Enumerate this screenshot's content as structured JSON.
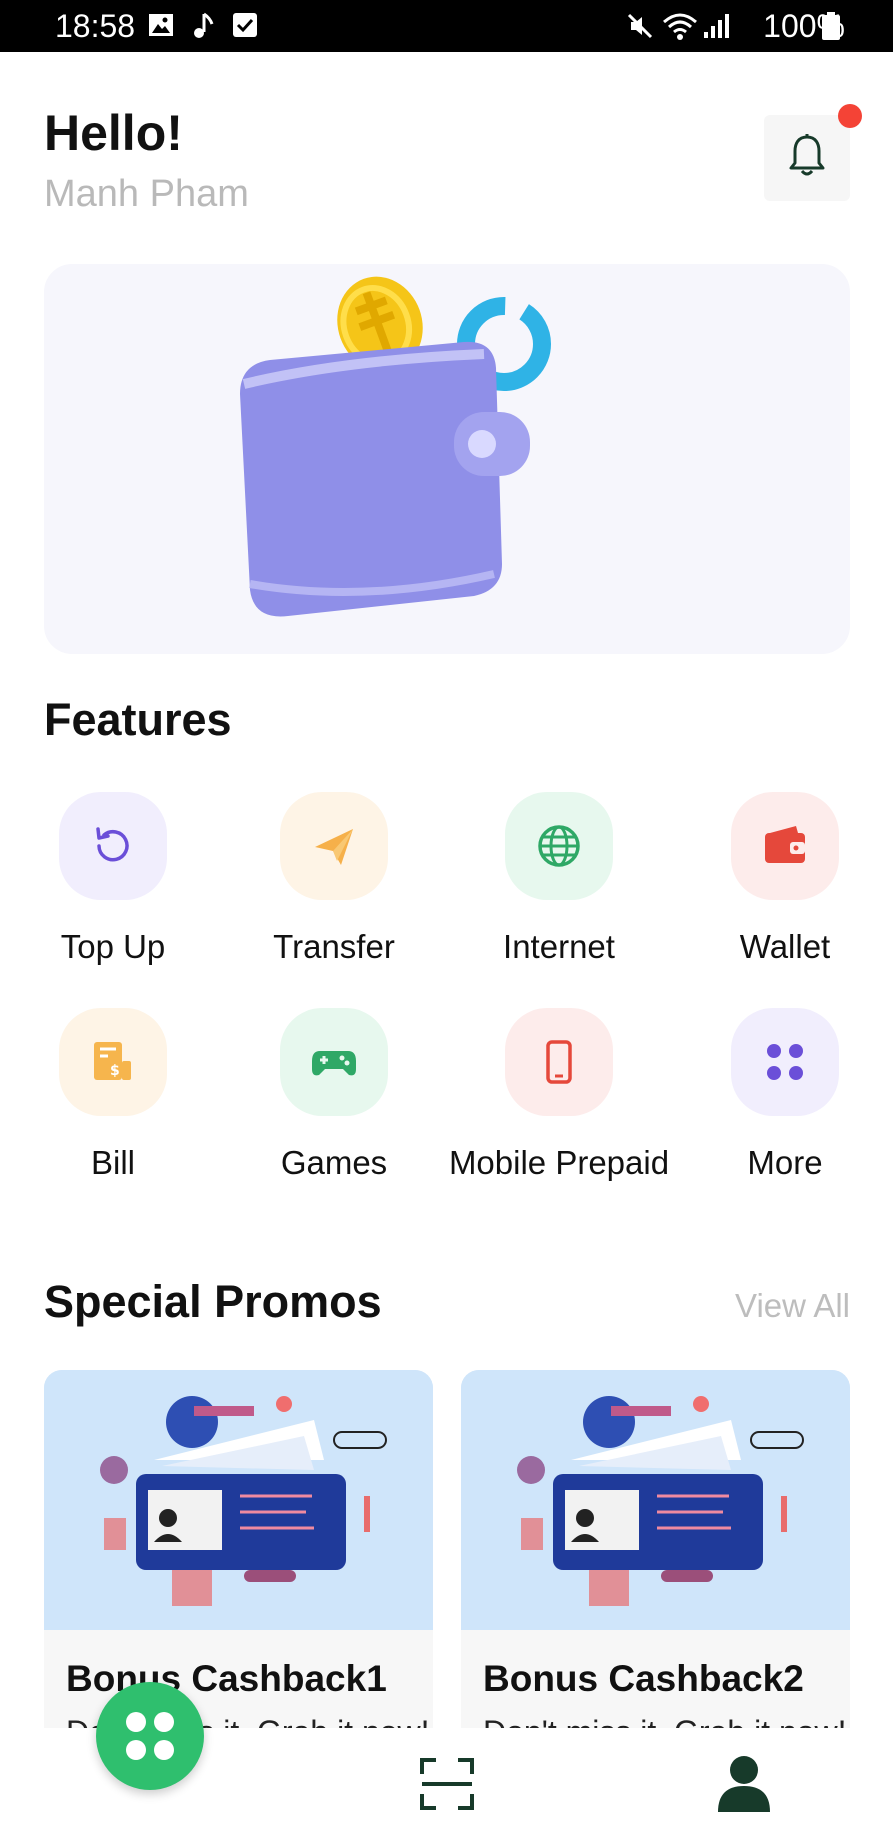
{
  "status_bar": {
    "time": "18:58",
    "battery": "100%",
    "left_icons": [
      "image-icon",
      "music-note-icon",
      "checkbox-icon"
    ],
    "right_icons": [
      "mute-icon",
      "wifi-icon",
      "signal-icon",
      "battery-icon"
    ]
  },
  "header": {
    "greeting": "Hello!",
    "username": "Manh Pham",
    "notification_icon": "bell-icon",
    "has_notification": true
  },
  "banner": {
    "image": "wallet-illustration"
  },
  "features": {
    "title": "Features",
    "items": [
      {
        "label": "Top Up",
        "icon": "refresh-icon",
        "color": "#6b4fd8",
        "bg": "#f1eefd"
      },
      {
        "label": "Transfer",
        "icon": "send-icon",
        "color": "#f6b04a",
        "bg": "#fef4e6"
      },
      {
        "label": "Internet",
        "icon": "globe-icon",
        "color": "#2fa866",
        "bg": "#e7f8ee"
      },
      {
        "label": "Wallet",
        "icon": "wallet-icon",
        "color": "#e5483b",
        "bg": "#fdeceb"
      },
      {
        "label": "Bill",
        "icon": "bill-icon",
        "color": "#f6b54d",
        "bg": "#fef4e6"
      },
      {
        "label": "Games",
        "icon": "gamepad-icon",
        "color": "#2fa866",
        "bg": "#e7f8ee"
      },
      {
        "label": "Mobile Prepaid",
        "icon": "phone-icon",
        "color": "#e5483b",
        "bg": "#fdeceb"
      },
      {
        "label": "More",
        "icon": "grid-icon",
        "color": "#6b4fd8",
        "bg": "#f1eefd"
      }
    ]
  },
  "promos": {
    "title": "Special Promos",
    "view_all": "View All",
    "items": [
      {
        "title": "Bonus Cashback1",
        "description": "Don't miss it. Grab it now!"
      },
      {
        "title": "Bonus Cashback2",
        "description": "Don't miss it. Grab it now!"
      }
    ]
  },
  "bottom_nav": {
    "items": [
      "home-grid-icon",
      "scan-icon",
      "profile-icon"
    ]
  },
  "colors": {
    "accent": "#2fbf6e",
    "notification": "#f44336",
    "dark_green": "#173a2a"
  }
}
